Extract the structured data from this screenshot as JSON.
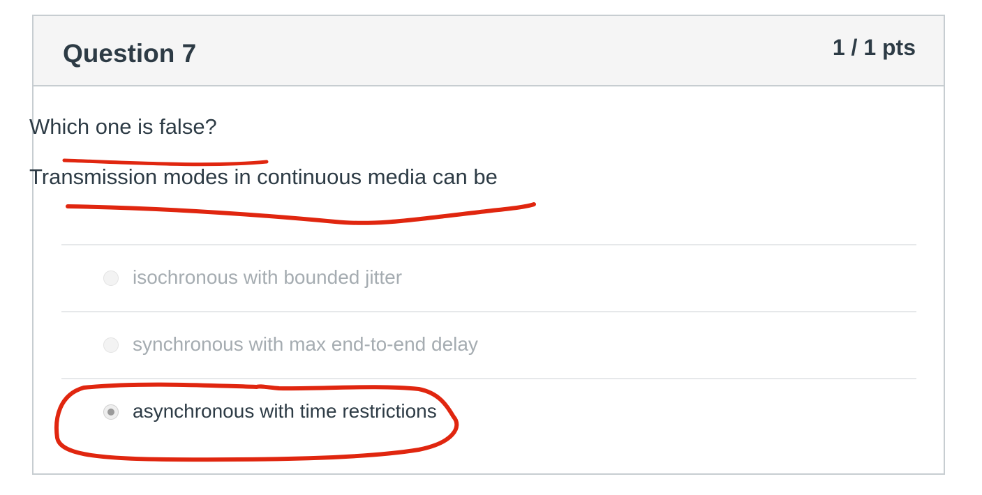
{
  "question": {
    "title": "Question 7",
    "points": "1 / 1 pts",
    "text_line_1": "Which one is false?",
    "text_line_2": "Transmission modes in continuous media can be"
  },
  "answers": [
    {
      "label": "isochronous with bounded jitter",
      "selected": false
    },
    {
      "label": "synchronous with max end-to-end delay",
      "selected": false
    },
    {
      "label": "asynchronous with time restrictions",
      "selected": true
    }
  ],
  "colors": {
    "annotation_ink": "#e0260f",
    "text": "#2d3b45",
    "muted_text": "#a5acb1",
    "header_bg": "#f5f5f5",
    "border": "#c7cdd1"
  }
}
